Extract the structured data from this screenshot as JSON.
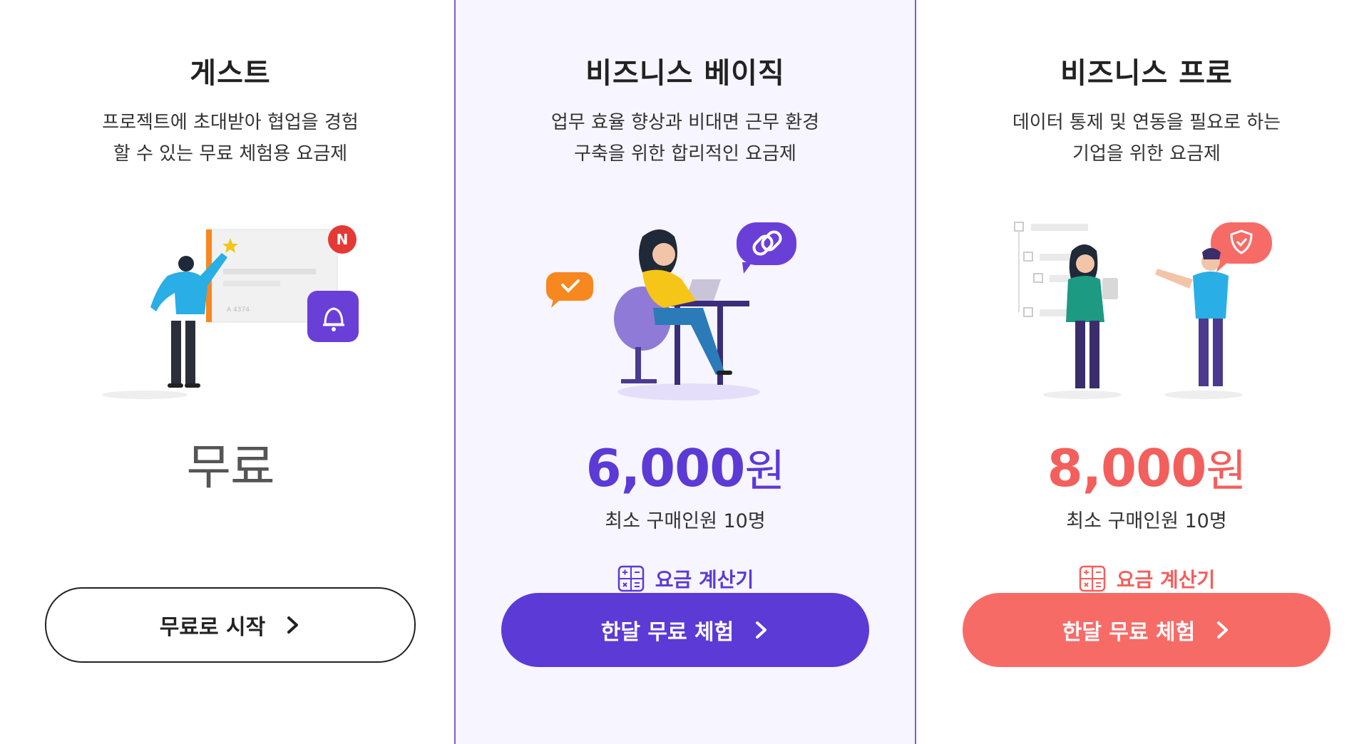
{
  "plans": [
    {
      "name": "게스트",
      "desc": [
        "프로젝트에 초대받아 협업을 경험",
        "할 수 있는 무료 체험용 요금제"
      ],
      "price_num": "무료",
      "price_unit": "",
      "min_buy": "",
      "calc_label": "",
      "cta_label": "무료로 시작",
      "accent": "#222222"
    },
    {
      "name": "비즈니스 베이직",
      "desc": [
        "업무 효율 향상과 비대면 근무 환경",
        "구축을 위한 합리적인 요금제"
      ],
      "price_num": "6,000",
      "price_unit": "원",
      "min_buy": "최소 구매인원 10명",
      "calc_label": "요금 계산기",
      "cta_label": "한달 무료 체험",
      "accent": "#5b3ad6"
    },
    {
      "name": "비즈니스 프로",
      "desc": [
        "데이터 통제 및 연동을 필요로 하는",
        "기업을 위한 요금제"
      ],
      "price_num": "8,000",
      "price_unit": "원",
      "min_buy": "최소 구매인원 10명",
      "calc_label": "요금 계산기",
      "cta_label": "한달 무료 체험",
      "accent": "#f25f5c"
    }
  ],
  "illustrations": {
    "guest": {
      "badge": "N",
      "icons": [
        "star-icon",
        "bell-icon"
      ]
    },
    "basic": {
      "icons": [
        "check-bubble-icon",
        "link-bubble-icon",
        "laptop-icon"
      ]
    },
    "pro": {
      "icons": [
        "shield-bubble-icon",
        "tree-diagram-icon"
      ]
    }
  }
}
